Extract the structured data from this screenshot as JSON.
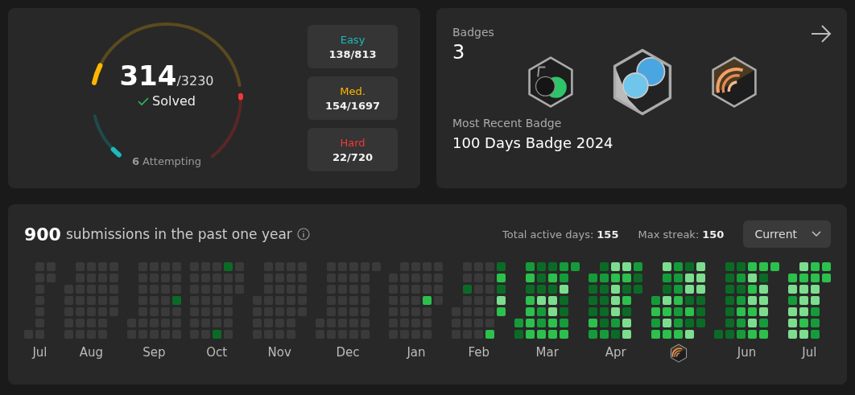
{
  "progress": {
    "solved": "314",
    "total": "/3230",
    "solved_label": "Solved",
    "attempting_count": "6",
    "attempting_label": "Attempting",
    "ring": [
      {
        "kind": "easy",
        "level": 0.17
      },
      {
        "kind": "medium",
        "level": 0.09
      },
      {
        "kind": "hard",
        "level": 0.03
      }
    ],
    "difficulties": [
      {
        "kind": "easy",
        "label": "Easy",
        "count": "138/813"
      },
      {
        "kind": "medium",
        "label": "Med.",
        "count": "154/1697"
      },
      {
        "kind": "hard",
        "label": "Hard",
        "count": "22/720"
      }
    ]
  },
  "badges": {
    "title": "Badges",
    "count": "3",
    "items": [
      {
        "kind": "fifty-days"
      },
      {
        "kind": "hundred-days"
      },
      {
        "kind": "may"
      }
    ],
    "recent_label": "Most Recent Badge",
    "recent_name": "100 Days Badge 2024"
  },
  "submissions": {
    "count": "900",
    "label": "submissions in the past one year",
    "active_days_label": "Total active days:",
    "active_days": "155",
    "max_streak_label": "Max streak:",
    "max_streak": "150",
    "dropdown": "Current",
    "months": [
      {
        "kind": "text",
        "label": "Jul",
        "weeks": [
          [
            {
              "color": "#3a3a3a"
            }
          ],
          [
            {
              "color": "#3a3a3a"
            },
            {
              "color": "#3a3a3a"
            },
            {
              "color": "#3a3a3a"
            },
            {
              "color": "#3a3a3a"
            },
            {
              "color": "#3a3a3a"
            },
            {
              "color": "#3a3a3a"
            },
            {
              "color": "#3a3a3a"
            }
          ],
          [
            {
              "color": "#3a3a3a"
            },
            {
              "color": "#3a3a3a"
            }
          ]
        ]
      },
      {
        "kind": "text",
        "label": "Aug",
        "weeks": [
          [
            {
              "color": "#3a3a3a"
            },
            {
              "color": "#3a3a3a"
            },
            {
              "color": "#3a3a3a"
            },
            {
              "color": "#3a3a3a"
            },
            {
              "color": "#3a3a3a"
            }
          ],
          [
            {
              "color": "#3a3a3a"
            },
            {
              "color": "#3a3a3a"
            },
            {
              "color": "#3a3a3a"
            },
            {
              "color": "#3a3a3a"
            },
            {
              "color": "#3a3a3a"
            },
            {
              "color": "#3a3a3a"
            },
            {
              "color": "#3a3a3a"
            }
          ],
          [
            {
              "color": "#3a3a3a"
            },
            {
              "color": "#3a3a3a"
            },
            {
              "color": "#3a3a3a"
            },
            {
              "color": "#3a3a3a"
            },
            {
              "color": "#3a3a3a"
            },
            {
              "color": "#3a3a3a"
            },
            {
              "color": "#3a3a3a"
            }
          ],
          [
            {
              "color": "#3a3a3a"
            },
            {
              "color": "#3a3a3a"
            },
            {
              "color": "#3a3a3a"
            },
            {
              "color": "#3a3a3a"
            },
            {
              "color": "#3a3a3a"
            },
            {
              "color": "#3a3a3a"
            },
            {
              "color": "#3a3a3a"
            }
          ],
          [
            {
              "color": "#3a3a3a"
            },
            {
              "color": "#3a3a3a"
            },
            {
              "color": "#3a3a3a"
            },
            {
              "color": "#3a3a3a"
            },
            {
              "color": "#3a3a3a"
            }
          ]
        ]
      },
      {
        "kind": "text",
        "label": "Sep",
        "weeks": [
          [
            {
              "color": "#3a3a3a"
            },
            {
              "color": "#3a3a3a"
            }
          ],
          [
            {
              "color": "#3a3a3a"
            },
            {
              "color": "#3a3a3a"
            },
            {
              "color": "#3a3a3a"
            },
            {
              "color": "#3a3a3a"
            },
            {
              "color": "#3a3a3a"
            },
            {
              "color": "#3a3a3a"
            },
            {
              "color": "#3a3a3a"
            }
          ],
          [
            {
              "color": "#3a3a3a"
            },
            {
              "color": "#3a3a3a"
            },
            {
              "color": "#3a3a3a"
            },
            {
              "color": "#3a3a3a"
            },
            {
              "color": "#3a3a3a"
            },
            {
              "color": "#3a3a3a"
            },
            {
              "color": "#3a3a3a"
            }
          ],
          [
            {
              "color": "#3a3a3a"
            },
            {
              "color": "#3a3a3a"
            },
            {
              "color": "#3a3a3a"
            },
            {
              "color": "#3a3a3a"
            },
            {
              "color": "#3a3a3a"
            },
            {
              "color": "#3a3a3a"
            },
            {
              "color": "#3a3a3a"
            }
          ],
          [
            {
              "color": "#3a3a3a"
            },
            {
              "color": "#3a3a3a"
            },
            {
              "color": "#3a3a3a"
            },
            {
              "color": "#0b6b26"
            },
            {
              "color": "#3a3a3a"
            },
            {
              "color": "#3a3a3a"
            },
            {
              "color": "#3a3a3a"
            }
          ]
        ]
      },
      {
        "kind": "text",
        "label": "Oct",
        "weeks": [
          [
            {
              "color": "#3a3a3a"
            },
            {
              "color": "#3a3a3a"
            },
            {
              "color": "#3a3a3a"
            },
            {
              "color": "#3a3a3a"
            },
            {
              "color": "#3a3a3a"
            },
            {
              "color": "#3a3a3a"
            },
            {
              "color": "#3a3a3a"
            }
          ],
          [
            {
              "color": "#3a3a3a"
            },
            {
              "color": "#3a3a3a"
            },
            {
              "color": "#3a3a3a"
            },
            {
              "color": "#3a3a3a"
            },
            {
              "color": "#3a3a3a"
            },
            {
              "color": "#3a3a3a"
            },
            {
              "color": "#3a3a3a"
            }
          ],
          [
            {
              "color": "#3a3a3a"
            },
            {
              "color": "#3a3a3a"
            },
            {
              "color": "#3a3a3a"
            },
            {
              "color": "#3a3a3a"
            },
            {
              "color": "#3a3a3a"
            },
            {
              "color": "#3a3a3a"
            },
            {
              "color": "#0b6b26"
            }
          ],
          [
            {
              "color": "#0b6b26"
            },
            {
              "color": "#3a3a3a"
            },
            {
              "color": "#3a3a3a"
            },
            {
              "color": "#3a3a3a"
            },
            {
              "color": "#3a3a3a"
            },
            {
              "color": "#3a3a3a"
            },
            {
              "color": "#3a3a3a"
            }
          ],
          [
            {
              "color": "#3a3a3a"
            },
            {
              "color": "#3a3a3a"
            },
            {
              "color": "#3a3a3a"
            }
          ]
        ]
      },
      {
        "kind": "text",
        "label": "Nov",
        "weeks": [
          [
            {
              "color": "#3a3a3a"
            },
            {
              "color": "#3a3a3a"
            },
            {
              "color": "#3a3a3a"
            },
            {
              "color": "#3a3a3a"
            }
          ],
          [
            {
              "color": "#3a3a3a"
            },
            {
              "color": "#3a3a3a"
            },
            {
              "color": "#3a3a3a"
            },
            {
              "color": "#3a3a3a"
            },
            {
              "color": "#3a3a3a"
            },
            {
              "color": "#3a3a3a"
            },
            {
              "color": "#3a3a3a"
            }
          ],
          [
            {
              "color": "#3a3a3a"
            },
            {
              "color": "#3a3a3a"
            },
            {
              "color": "#3a3a3a"
            },
            {
              "color": "#3a3a3a"
            },
            {
              "color": "#3a3a3a"
            },
            {
              "color": "#3a3a3a"
            },
            {
              "color": "#3a3a3a"
            }
          ],
          [
            {
              "color": "#3a3a3a"
            },
            {
              "color": "#3a3a3a"
            },
            {
              "color": "#3a3a3a"
            },
            {
              "color": "#3a3a3a"
            },
            {
              "color": "#3a3a3a"
            },
            {
              "color": "#3a3a3a"
            },
            {
              "color": "#3a3a3a"
            }
          ],
          [
            {
              "color": "#3a3a3a"
            },
            {
              "color": "#3a3a3a"
            },
            {
              "color": "#3a3a3a"
            },
            {
              "color": "#3a3a3a"
            },
            {
              "color": "#3a3a3a"
            }
          ]
        ]
      },
      {
        "kind": "text",
        "label": "Dec",
        "weeks": [
          [
            {
              "color": "#3a3a3a"
            },
            {
              "color": "#3a3a3a"
            }
          ],
          [
            {
              "color": "#3a3a3a"
            },
            {
              "color": "#3a3a3a"
            },
            {
              "color": "#3a3a3a"
            },
            {
              "color": "#3a3a3a"
            },
            {
              "color": "#3a3a3a"
            },
            {
              "color": "#3a3a3a"
            },
            {
              "color": "#3a3a3a"
            }
          ],
          [
            {
              "color": "#3a3a3a"
            },
            {
              "color": "#3a3a3a"
            },
            {
              "color": "#3a3a3a"
            },
            {
              "color": "#3a3a3a"
            },
            {
              "color": "#3a3a3a"
            },
            {
              "color": "#3a3a3a"
            },
            {
              "color": "#3a3a3a"
            }
          ],
          [
            {
              "color": "#3a3a3a"
            },
            {
              "color": "#3a3a3a"
            },
            {
              "color": "#3a3a3a"
            },
            {
              "color": "#3a3a3a"
            },
            {
              "color": "#3a3a3a"
            },
            {
              "color": "#3a3a3a"
            },
            {
              "color": "#3a3a3a"
            }
          ],
          [
            {
              "color": "#3a3a3a"
            },
            {
              "color": "#3a3a3a"
            },
            {
              "color": "#3a3a3a"
            },
            {
              "color": "#3a3a3a"
            },
            {
              "color": "#3a3a3a"
            },
            {
              "color": "#3a3a3a"
            },
            {
              "color": "#3a3a3a"
            }
          ],
          [
            {
              "color": "#3a3a3a"
            }
          ]
        ]
      },
      {
        "kind": "text",
        "label": "Jan",
        "weeks": [
          [
            {
              "color": "#3a3a3a"
            },
            {
              "color": "#3a3a3a"
            },
            {
              "color": "#3a3a3a"
            },
            {
              "color": "#3a3a3a"
            },
            {
              "color": "#3a3a3a"
            },
            {
              "color": "#3a3a3a"
            }
          ],
          [
            {
              "color": "#3a3a3a"
            },
            {
              "color": "#3a3a3a"
            },
            {
              "color": "#3a3a3a"
            },
            {
              "color": "#3a3a3a"
            },
            {
              "color": "#3a3a3a"
            },
            {
              "color": "#3a3a3a"
            },
            {
              "color": "#3a3a3a"
            }
          ],
          [
            {
              "color": "#3a3a3a"
            },
            {
              "color": "#3a3a3a"
            },
            {
              "color": "#3a3a3a"
            },
            {
              "color": "#3a3a3a"
            },
            {
              "color": "#3a3a3a"
            },
            {
              "color": "#3a3a3a"
            },
            {
              "color": "#3a3a3a"
            }
          ],
          [
            {
              "color": "#3a3a3a"
            },
            {
              "color": "#3a3a3a"
            },
            {
              "color": "#3a3a3a"
            },
            {
              "color": "#2cc04d"
            },
            {
              "color": "#3a3a3a"
            },
            {
              "color": "#3a3a3a"
            },
            {
              "color": "#3a3a3a"
            }
          ],
          [
            {
              "color": "#3a3a3a"
            },
            {
              "color": "#3a3a3a"
            },
            {
              "color": "#3a3a3a"
            },
            {
              "color": "#3a3a3a"
            }
          ]
        ]
      },
      {
        "kind": "text",
        "label": "Feb",
        "weeks": [
          [
            {
              "color": "#3a3a3a"
            },
            {
              "color": "#3a3a3a"
            },
            {
              "color": "#3a3a3a"
            }
          ],
          [
            {
              "color": "#3a3a3a"
            },
            {
              "color": "#3a3a3a"
            },
            {
              "color": "#0b6b26"
            },
            {
              "color": "#3a3a3a"
            },
            {
              "color": "#3a3a3a"
            },
            {
              "color": "#3a3a3a"
            },
            {
              "color": "#3a3a3a"
            }
          ],
          [
            {
              "color": "#3a3a3a"
            },
            {
              "color": "#3a3a3a"
            },
            {
              "color": "#3a3a3a"
            },
            {
              "color": "#3a3a3a"
            },
            {
              "color": "#3a3a3a"
            },
            {
              "color": "#3a3a3a"
            },
            {
              "color": "#3a3a3a"
            }
          ],
          [
            {
              "color": "#3a3a3a"
            },
            {
              "color": "#3a3a3a"
            },
            {
              "color": "#3a3a3a"
            },
            {
              "color": "#3a3a3a"
            },
            {
              "color": "#3a3a3a"
            },
            {
              "color": "#3a3a3a"
            },
            {
              "color": "#2cc04d"
            }
          ],
          [
            {
              "color": "#0b6b26"
            },
            {
              "color": "#2cc04d"
            },
            {
              "color": "#0b6b26"
            },
            {
              "color": "#7ddd8f"
            },
            {
              "color": "#2cc04d"
            }
          ]
        ]
      },
      {
        "kind": "text",
        "label": "Mar",
        "weeks": [
          [
            {
              "color": "#159b39"
            },
            {
              "color": "#0b6b26"
            }
          ],
          [
            {
              "color": "#159b39"
            },
            {
              "color": "#2cc04d"
            },
            {
              "color": "#0b6b26"
            },
            {
              "color": "#2cc04d"
            },
            {
              "color": "#2cc04d"
            },
            {
              "color": "#2cc04d"
            },
            {
              "color": "#2cc04d"
            }
          ],
          [
            {
              "color": "#0b6b26"
            },
            {
              "color": "#0b6b26"
            },
            {
              "color": "#0b6b26"
            },
            {
              "color": "#7ddd8f"
            },
            {
              "color": "#159b39"
            },
            {
              "color": "#159b39"
            },
            {
              "color": "#2cc04d"
            }
          ],
          [
            {
              "color": "#0b6b26"
            },
            {
              "color": "#2cc04d"
            },
            {
              "color": "#0b6b26"
            },
            {
              "color": "#7ddd8f"
            },
            {
              "color": "#7ddd8f"
            },
            {
              "color": "#2cc04d"
            },
            {
              "color": "#2cc04d"
            }
          ],
          [
            {
              "color": "#159b39"
            },
            {
              "color": "#159b39"
            },
            {
              "color": "#7ddd8f"
            },
            {
              "color": "#0b6b26"
            },
            {
              "color": "#0b6b26"
            },
            {
              "color": "#159b39"
            },
            {
              "color": "#2cc04d"
            }
          ],
          [
            {
              "color": "#159b39"
            }
          ]
        ]
      },
      {
        "kind": "text",
        "label": "Apr",
        "weeks": [
          [
            {
              "color": "#159b39"
            },
            {
              "color": "#0b6b26"
            },
            {
              "color": "#0b6b26"
            },
            {
              "color": "#0b6b26"
            },
            {
              "color": "#2cc04d"
            },
            {
              "color": "#159b39"
            }
          ],
          [
            {
              "color": "#0b6b26"
            },
            {
              "color": "#159b39"
            },
            {
              "color": "#0b6b26"
            },
            {
              "color": "#0b6b26"
            },
            {
              "color": "#0b6b26"
            },
            {
              "color": "#0b6b26"
            },
            {
              "color": "#159b39"
            }
          ],
          [
            {
              "color": "#7ddd8f"
            },
            {
              "color": "#2cc04d"
            },
            {
              "color": "#7ddd8f"
            },
            {
              "color": "#7ddd8f"
            },
            {
              "color": "#7ddd8f"
            },
            {
              "color": "#159b39"
            },
            {
              "color": "#0b6b26"
            }
          ],
          [
            {
              "color": "#7ddd8f"
            },
            {
              "color": "#2cc04d"
            },
            {
              "color": "#0b6b26"
            },
            {
              "color": "#2cc04d"
            },
            {
              "color": "#0b6b26"
            },
            {
              "color": "#7ddd8f"
            },
            {
              "color": "#7ddd8f"
            }
          ],
          [
            {
              "color": "#159b39"
            },
            {
              "color": "#0b6b26"
            },
            {
              "color": "#0b6b26"
            }
          ]
        ]
      },
      {
        "kind": "badge",
        "weeks": [
          [
            {
              "color": "#159b39"
            },
            {
              "color": "#2cc04d"
            },
            {
              "color": "#159b39"
            },
            {
              "color": "#2cc04d"
            }
          ],
          [
            {
              "color": "#7ddd8f"
            },
            {
              "color": "#159b39"
            },
            {
              "color": "#0b6b26"
            },
            {
              "color": "#7ddd8f"
            },
            {
              "color": "#2cc04d"
            },
            {
              "color": "#7ddd8f"
            },
            {
              "color": "#2cc04d"
            }
          ],
          [
            {
              "color": "#159b39"
            },
            {
              "color": "#159b39"
            },
            {
              "color": "#159b39"
            },
            {
              "color": "#2cc04d"
            },
            {
              "color": "#159b39"
            },
            {
              "color": "#159b39"
            },
            {
              "color": "#2cc04d"
            }
          ],
          [
            {
              "color": "#0b6b26"
            },
            {
              "color": "#7ddd8f"
            },
            {
              "color": "#7ddd8f"
            },
            {
              "color": "#0b6b26"
            },
            {
              "color": "#2cc04d"
            },
            {
              "color": "#0b6b26"
            },
            {
              "color": "#7ddd8f"
            }
          ],
          [
            {
              "color": "#7ddd8f"
            },
            {
              "color": "#7ddd8f"
            },
            {
              "color": "#7ddd8f"
            },
            {
              "color": "#0b6b26"
            },
            {
              "color": "#0b6b26"
            },
            {
              "color": "#0b6b26"
            }
          ]
        ]
      },
      {
        "kind": "text",
        "label": "Jun",
        "weeks": [
          [
            {
              "color": "#0b6b26"
            }
          ],
          [
            {
              "color": "#0b6b26"
            },
            {
              "color": "#0b6b26"
            },
            {
              "color": "#0b6b26"
            },
            {
              "color": "#0b6b26"
            },
            {
              "color": "#0b6b26"
            },
            {
              "color": "#0b6b26"
            },
            {
              "color": "#0b6b26"
            }
          ],
          [
            {
              "color": "#0b6b26"
            },
            {
              "color": "#159b39"
            },
            {
              "color": "#0b6b26"
            },
            {
              "color": "#159b39"
            },
            {
              "color": "#2cc04d"
            },
            {
              "color": "#159b39"
            },
            {
              "color": "#159b39"
            }
          ],
          [
            {
              "color": "#2cc04d"
            },
            {
              "color": "#7ddd8f"
            },
            {
              "color": "#2cc04d"
            },
            {
              "color": "#7ddd8f"
            },
            {
              "color": "#2cc04d"
            },
            {
              "color": "#7ddd8f"
            },
            {
              "color": "#2cc04d"
            }
          ],
          [
            {
              "color": "#2cc04d"
            },
            {
              "color": "#0b6b26"
            },
            {
              "color": "#7ddd8f"
            },
            {
              "color": "#7ddd8f"
            },
            {
              "color": "#7ddd8f"
            },
            {
              "color": "#159b39"
            },
            {
              "color": "#2cc04d"
            }
          ],
          [
            {
              "color": "#2cc04d"
            }
          ]
        ]
      },
      {
        "kind": "text",
        "label": "Jul",
        "weeks": [
          [
            {
              "color": "#2cc04d"
            },
            {
              "color": "#7ddd8f"
            },
            {
              "color": "#159b39"
            },
            {
              "color": "#7ddd8f"
            },
            {
              "color": "#7ddd8f"
            },
            {
              "color": "#7ddd8f"
            }
          ],
          [
            {
              "color": "#7ddd8f"
            },
            {
              "color": "#2cc04d"
            },
            {
              "color": "#7ddd8f"
            },
            {
              "color": "#7ddd8f"
            },
            {
              "color": "#7ddd8f"
            },
            {
              "color": "#2cc04d"
            },
            {
              "color": "#7ddd8f"
            }
          ],
          [
            {
              "color": "#2cc04d"
            },
            {
              "color": "#2cc04d"
            },
            {
              "color": "#7ddd8f"
            },
            {
              "color": "#7ddd8f"
            },
            {
              "color": "#159b39"
            },
            {
              "color": "#159b39"
            },
            {
              "color": "#159b39"
            }
          ],
          [
            {
              "color": "#2cc04d"
            },
            {
              "color": "#2cc04d"
            }
          ]
        ]
      }
    ]
  }
}
